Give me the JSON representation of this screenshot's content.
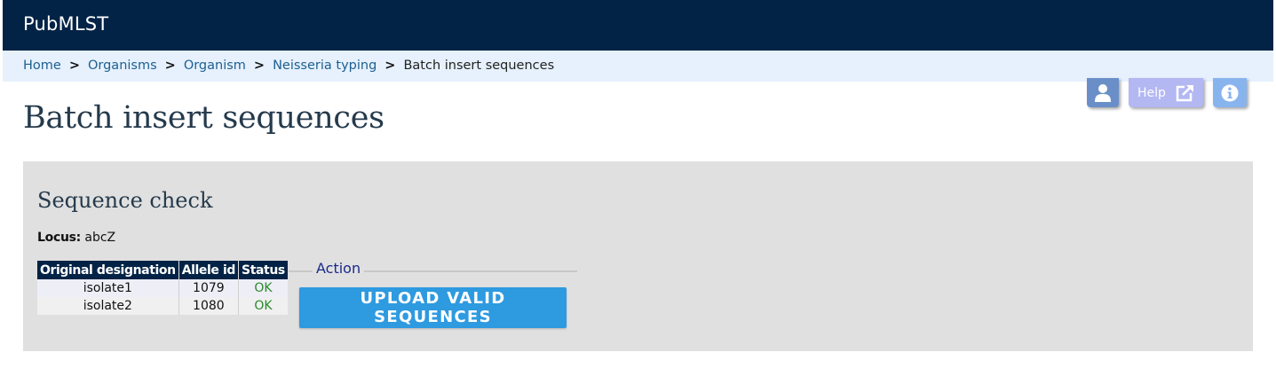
{
  "header": {
    "brand": "PubMLST"
  },
  "breadcrumb": {
    "items": [
      "Home",
      "Organisms",
      "Organism",
      "Neisseria typing"
    ],
    "current": "Batch insert sequences",
    "separator": ">"
  },
  "toolbar": {
    "help_label": "Help"
  },
  "page": {
    "title": "Batch insert sequences"
  },
  "check": {
    "heading": "Sequence check",
    "locus_label": "Locus:",
    "locus_value": "abcZ",
    "columns": [
      "Original designation",
      "Allele id",
      "Status"
    ],
    "rows": [
      {
        "designation": "isolate1",
        "allele_id": "1079",
        "status": "OK"
      },
      {
        "designation": "isolate2",
        "allele_id": "1080",
        "status": "OK"
      }
    ]
  },
  "action": {
    "legend": "Action",
    "upload_label": "UPLOAD VALID SEQUENCES"
  },
  "icons": [
    "user-icon",
    "external-link-icon",
    "info-icon"
  ]
}
